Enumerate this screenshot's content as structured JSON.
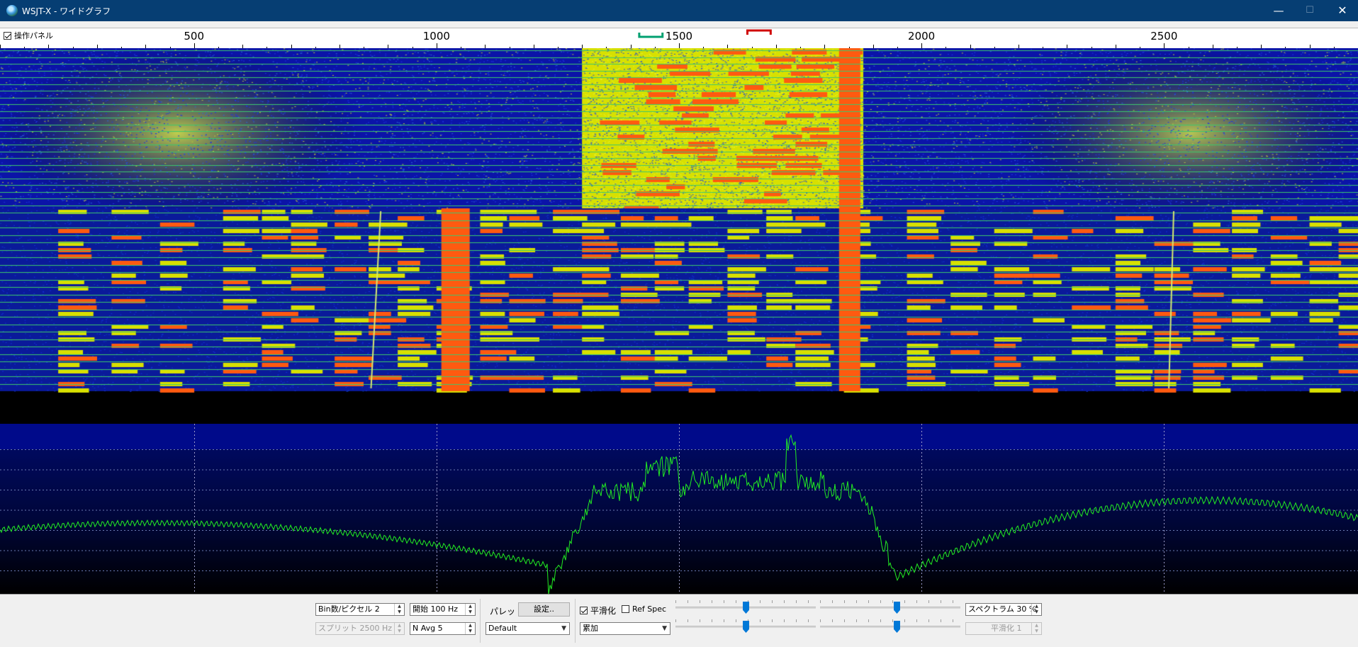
{
  "window": {
    "title": "WSJT-X - ワイドグラフ",
    "minimize_glyph": "—",
    "maximize_glyph": "☐",
    "close_glyph": "✕"
  },
  "scale": {
    "control_panel_label": "操作パネル",
    "control_panel_checked": true,
    "freq_min_hz": 100,
    "freq_max_hz": 2900,
    "tick_labels": [
      "500",
      "1000",
      "1500",
      "2000",
      "2500"
    ],
    "rx_marker_hz": [
      1418,
      1466
    ],
    "tx_marker_hz": [
      1641,
      1689
    ],
    "rx_marker_color": "#00a070",
    "tx_marker_color": "#d00000"
  },
  "spectrum": {
    "grid_hz": [
      500,
      1000,
      1500,
      2000,
      2500
    ],
    "trace_color": "#22ee22"
  },
  "controls": {
    "bins_per_pixel": "Bin数/ピクセル  2",
    "start": "開始  100 Hz",
    "split": "スプリット  2500  Hz",
    "n_avg": "N Avg 5",
    "palette_label": "パレット",
    "settings_button": "設定..",
    "palette_value": "Default",
    "smoothing_label": "平滑化",
    "smoothing_checked": true,
    "ref_spec_label": "Ref Spec",
    "ref_spec_checked": false,
    "mode_value": "累加",
    "spectrum_percent": "スペクトラム  30 %",
    "smoothing_value": "平滑化   1",
    "slider_levels": [
      0.5,
      0.55,
      0.5,
      0.55
    ]
  },
  "colors": {
    "titlebar": "#063e73",
    "waterfall_blue": "#0a1fc8",
    "waterfall_yellow": "#d8e000",
    "waterfall_orange": "#ff5a10",
    "slider_thumb": "#0078d7"
  }
}
